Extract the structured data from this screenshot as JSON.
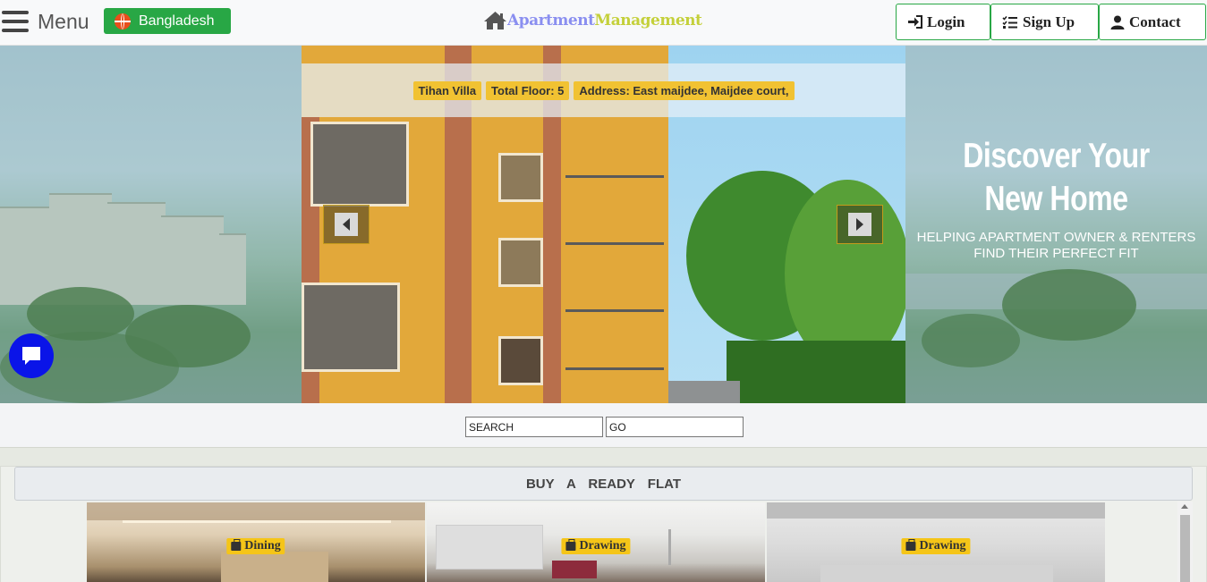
{
  "header": {
    "menu_label": "Menu",
    "country_label": "Bangladesh",
    "brand_part1": "Apartment",
    "brand_part2": "Management",
    "login_label": "Login",
    "signup_label": "Sign Up",
    "contact_label": "Contact"
  },
  "hero": {
    "pills": [
      "Tihan Villa",
      "Total Floor: 5",
      "Address: East maijdee, Maijdee court,"
    ],
    "headline": "Discover Your New Home",
    "subline": "HELPING APARTMENT OWNER & RENTERS FIND THEIR PERFECT FIT"
  },
  "search": {
    "search_value": "SEARCH",
    "go_value": "GO"
  },
  "section": {
    "title": "BUY A READY FLAT",
    "cards": [
      {
        "tag": "Dining"
      },
      {
        "tag": "Drawing"
      },
      {
        "tag": "Drawing"
      }
    ]
  },
  "colors": {
    "accent_green": "#28a745",
    "pill_yellow": "#f1c232",
    "chat_blue": "#0a14e8",
    "brand_blue": "#8a8ff0",
    "brand_lime": "#c4d03a"
  },
  "icons": [
    "hamburger-icon",
    "globe-icon",
    "house-icon",
    "login-icon",
    "list-check-icon",
    "user-icon",
    "chevron-left-icon",
    "chevron-right-icon",
    "chat-icon",
    "briefcase-icon"
  ]
}
